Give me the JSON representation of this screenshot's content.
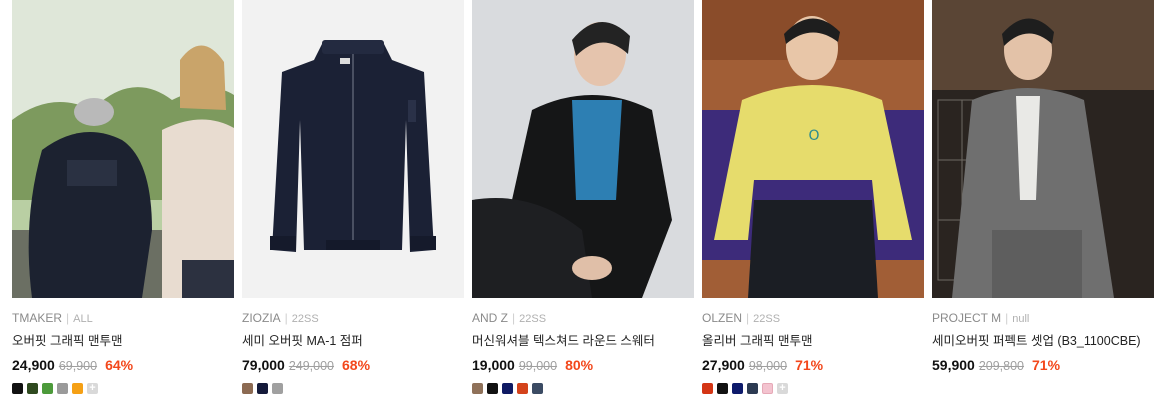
{
  "products": [
    {
      "brand": "TMAKER",
      "season": "ALL",
      "name": "오버핏 그래픽 맨투맨",
      "price": "24,900",
      "original_price": "69,900",
      "discount": "64%",
      "colors": [
        "#111111",
        "#2f4a1f",
        "#4c9a3a",
        "#9a9a9a",
        "#f5a015"
      ],
      "more_colors": "+",
      "image": "photo-two-models-sweatshirts",
      "palette": {
        "bg": "#a9c08f",
        "accent": "#1c2230",
        "skin": "#e1bfa3"
      }
    },
    {
      "brand": "ZIOZIA",
      "season": "22SS",
      "name": "세미 오버핏 MA-1 점퍼",
      "price": "79,000",
      "original_price": "249,000",
      "discount": "68%",
      "colors": [
        "#8c6a52",
        "#141a3a",
        "#a0a0a0"
      ],
      "image": "photo-navy-ma1-jacket",
      "palette": {
        "bg": "#f2f2f2",
        "accent": "#1b2135"
      }
    },
    {
      "brand": "AND Z",
      "season": "22SS",
      "name": "머신워셔블 텍스쳐드 라운드 스웨터",
      "price": "19,000",
      "original_price": "99,000",
      "discount": "80%",
      "colors": [
        "#8f7159",
        "#111111",
        "#0f1a63",
        "#d4431b",
        "#3b4b63"
      ],
      "image": "photo-model-black-leather-jacket",
      "palette": {
        "bg": "#dcdde0",
        "accent": "#151617",
        "skin": "#e5c4ad"
      }
    },
    {
      "brand": "OLZEN",
      "season": "22SS",
      "name": "올리버 그래픽 맨투맨",
      "price": "27,900",
      "original_price": "98,000",
      "discount": "71%",
      "colors": [
        "#d43515",
        "#111111",
        "#0d1a6b",
        "#2c3a52",
        "#f3c3cf"
      ],
      "more_colors": "+",
      "image": "photo-model-yellow-sweatshirt",
      "palette": {
        "bg": "#9a5a33",
        "accent": "#e6dc6c",
        "skin": "#e8c6a8"
      }
    },
    {
      "brand": "PROJECT M",
      "season": "null",
      "name": "세미오버핏 퍼펙트 셋업 (B3_1100CBE)",
      "price": "59,900",
      "original_price": "209,800",
      "discount": "71%",
      "colors": [],
      "image": "photo-model-gray-suit",
      "palette": {
        "bg": "#5e4a3b",
        "accent": "#6f6f6f",
        "skin": "#e3c2a8"
      }
    }
  ]
}
